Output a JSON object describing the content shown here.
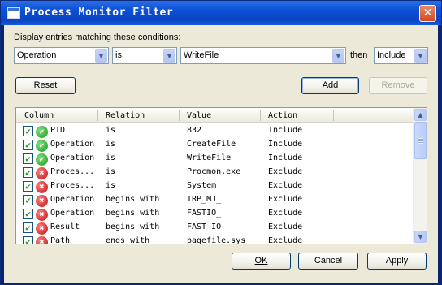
{
  "window": {
    "title": "Process Monitor Filter",
    "close_glyph": "✕"
  },
  "conditions_label": "Display entries matching these conditions:",
  "filter": {
    "column": "Operation",
    "relation": "is",
    "value": "WriteFile",
    "then_label": "then",
    "action": "Include"
  },
  "buttons": {
    "reset": "Reset",
    "add": "Add",
    "remove": "Remove",
    "ok": "OK",
    "cancel": "Cancel",
    "apply": "Apply"
  },
  "table": {
    "columns": [
      "Column",
      "Relation",
      "Value",
      "Action"
    ],
    "rows": [
      {
        "column": "PID",
        "relation": "is",
        "value": "832",
        "action": "Include",
        "enabled": true,
        "type": "include"
      },
      {
        "column": "Operation",
        "relation": "is",
        "value": "CreateFile",
        "action": "Include",
        "enabled": true,
        "type": "include"
      },
      {
        "column": "Operation",
        "relation": "is",
        "value": "WriteFile",
        "action": "Include",
        "enabled": true,
        "type": "include"
      },
      {
        "column": "Proces...",
        "relation": "is",
        "value": "Procmon.exe",
        "action": "Exclude",
        "enabled": true,
        "type": "exclude"
      },
      {
        "column": "Proces...",
        "relation": "is",
        "value": "System",
        "action": "Exclude",
        "enabled": true,
        "type": "exclude"
      },
      {
        "column": "Operation",
        "relation": "begins with",
        "value": "IRP_MJ_",
        "action": "Exclude",
        "enabled": true,
        "type": "exclude"
      },
      {
        "column": "Operation",
        "relation": "begins with",
        "value": "FASTIO_",
        "action": "Exclude",
        "enabled": true,
        "type": "exclude"
      },
      {
        "column": "Result",
        "relation": "begins with",
        "value": "FAST IO",
        "action": "Exclude",
        "enabled": true,
        "type": "exclude"
      },
      {
        "column": "Path",
        "relation": "ends with",
        "value": "pagefile.sys",
        "action": "Exclude",
        "enabled": true,
        "type": "exclude"
      }
    ]
  },
  "icons": {
    "include": "check-circle-icon",
    "exclude": "x-circle-icon",
    "checkbox": "checkbox-checked-icon"
  },
  "colors": {
    "titlebar": "#0a4fd6",
    "include_icon": "#1a9a1a",
    "exclude_icon": "#c01010",
    "dialog_bg": "#ece9d8"
  }
}
